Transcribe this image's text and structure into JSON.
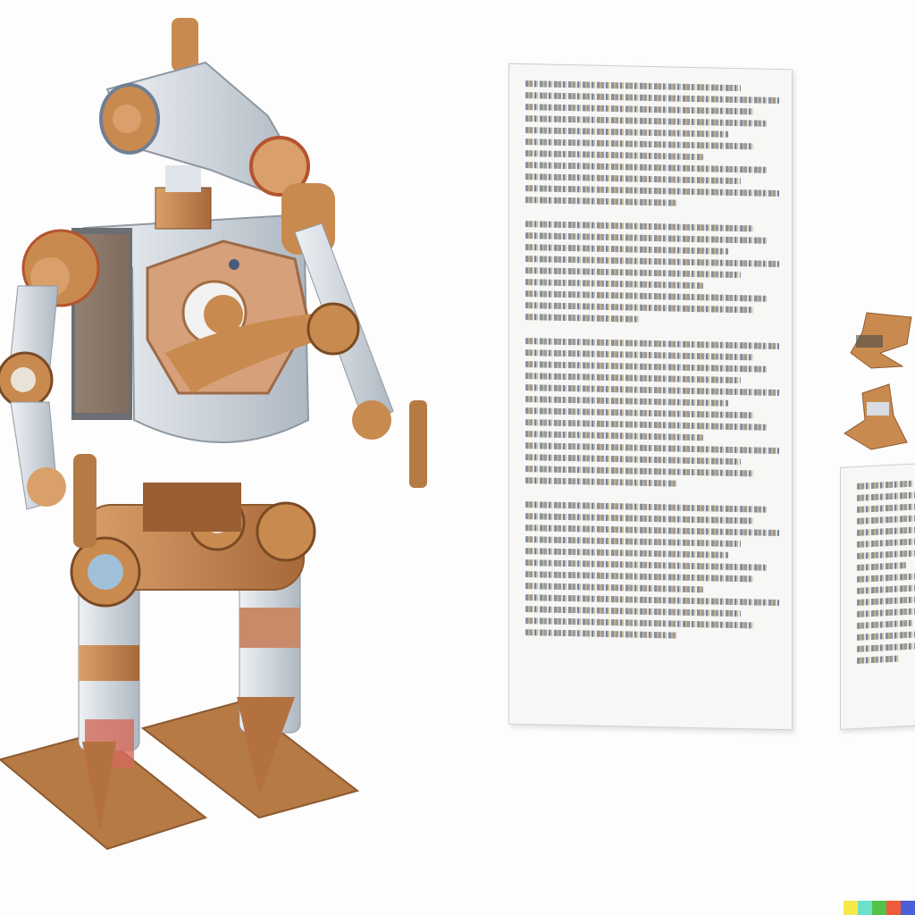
{
  "colors": {
    "background": "#fdfdfd",
    "copper": "#c98a4f",
    "copper_dark": "#a7683a",
    "steel": "#d7dde3",
    "steel_shadow": "#a9b2bb",
    "paper": "#f7f7f5"
  },
  "watermark": {
    "swatches": [
      "#f5e94a",
      "#6fe0c9",
      "#54c24a",
      "#ef5b3a",
      "#4a5fd8"
    ]
  },
  "icons": {
    "robot": "robot-figure-icon",
    "small_figure": "small-figure-icon",
    "document": "document-icon"
  }
}
